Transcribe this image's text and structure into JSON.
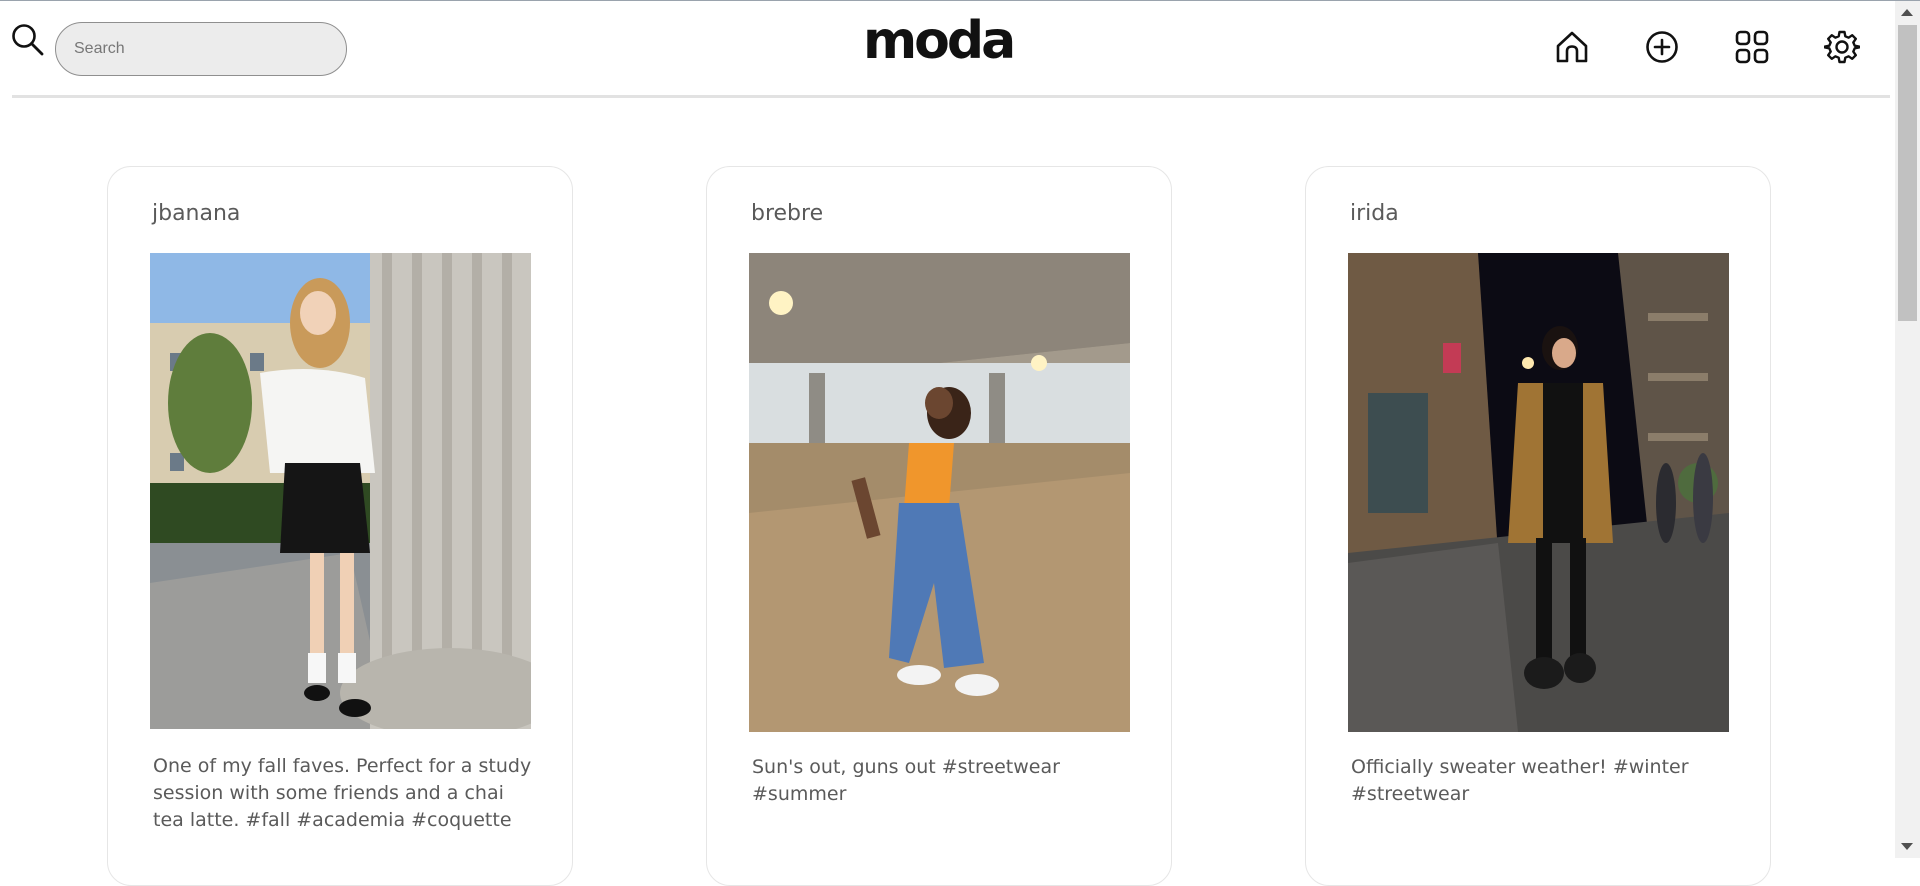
{
  "app": {
    "logo": "moda"
  },
  "search": {
    "placeholder": "Search",
    "value": ""
  },
  "nav": {
    "icons": [
      "home-icon",
      "add-circle-icon",
      "grid-icon",
      "gear-icon"
    ]
  },
  "posts": [
    {
      "username": "jbanana",
      "caption": "One of my fall faves. Perfect for a study session with some friends and a chai tea latte. #fall #academia #coquette"
    },
    {
      "username": "brebre",
      "caption": "Sun's out, guns out #streetwear #summer"
    },
    {
      "username": "irida",
      "caption": "Officially sweater weather! #winter #streetwear"
    }
  ],
  "colors": {
    "accent": "#111111",
    "text_muted": "#5a5a5a",
    "search_bg": "#ececec"
  }
}
